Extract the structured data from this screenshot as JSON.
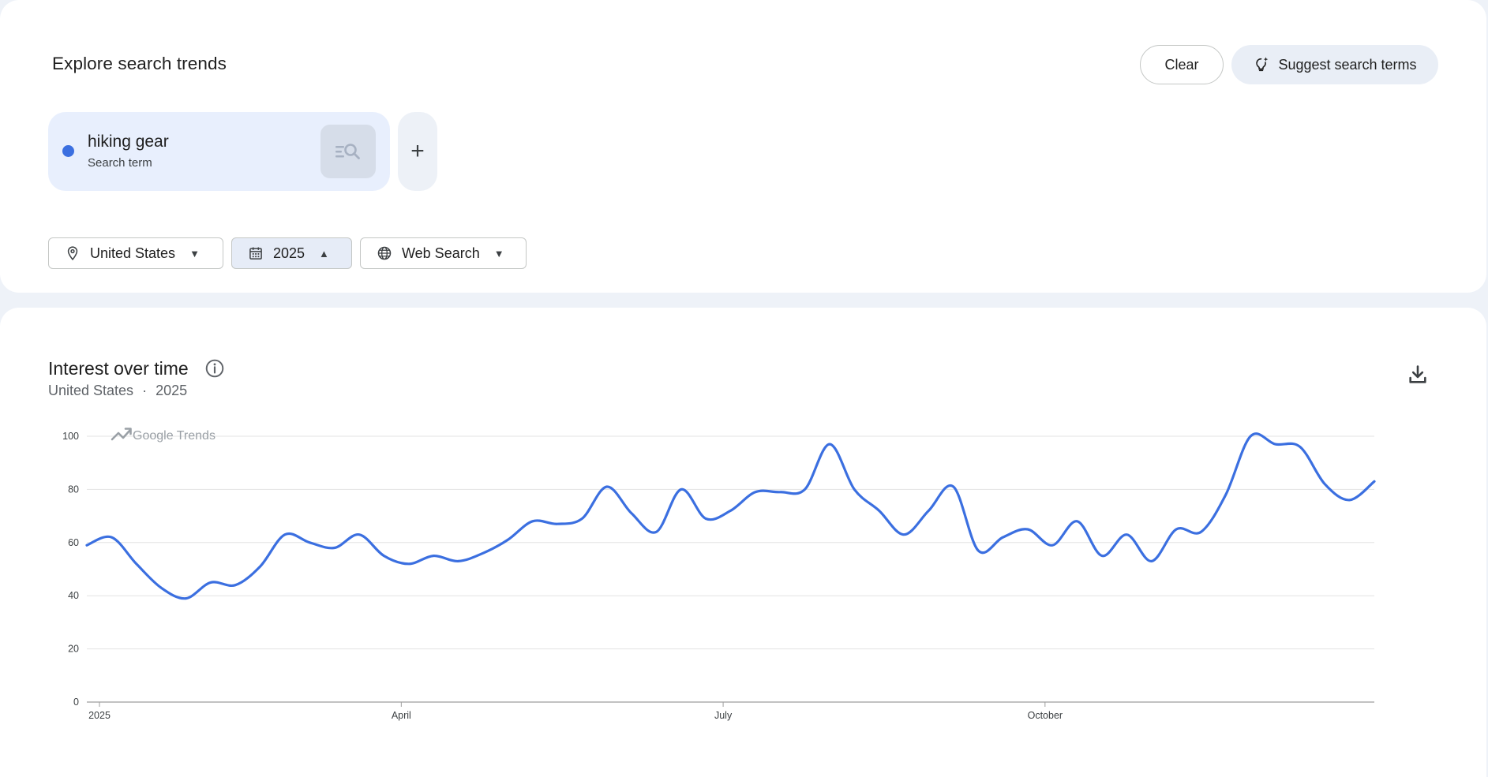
{
  "header": {
    "title": "Explore search trends",
    "clear_label": "Clear",
    "suggest_label": "Suggest search terms"
  },
  "term": {
    "name": "hiking gear",
    "sub": "Search term",
    "color": "#3b6fe0"
  },
  "add_term_label": "+",
  "filters": {
    "location": "United States",
    "date": "2025",
    "property": "Web Search"
  },
  "chart_card": {
    "title": "Interest over time",
    "subtitle_location": "United States",
    "subtitle_sep": "·",
    "subtitle_date": "2025",
    "watermark": "Google Trends"
  },
  "chart_data": {
    "type": "line",
    "title": "Interest over time",
    "xlabel": "",
    "ylabel": "",
    "ylim": [
      0,
      100
    ],
    "yticks": [
      0,
      20,
      40,
      60,
      80,
      100
    ],
    "grid": true,
    "x_tick_labels": [
      {
        "label": "2025",
        "week": 0
      },
      {
        "label": "April",
        "week": 12.7
      },
      {
        "label": "July",
        "week": 25.7
      },
      {
        "label": "October",
        "week": 38.7
      }
    ],
    "series": [
      {
        "name": "hiking gear",
        "color": "#3b6fe0",
        "weeks": [
          0,
          1,
          2,
          3,
          4,
          5,
          6,
          7,
          8,
          9,
          10,
          11,
          12,
          13,
          14,
          15,
          16,
          17,
          18,
          19,
          20,
          21,
          22,
          23,
          24,
          25,
          26,
          27,
          28,
          29,
          30,
          31,
          32,
          33,
          34,
          35,
          36,
          37,
          38,
          39,
          40,
          41,
          42,
          43,
          44,
          45,
          46,
          47,
          48,
          49,
          50,
          51,
          52
        ],
        "values": [
          59,
          62,
          52,
          43,
          39,
          45,
          44,
          51,
          63,
          60,
          58,
          63,
          55,
          52,
          55,
          53,
          56,
          61,
          68,
          67,
          69,
          81,
          71,
          64,
          80,
          69,
          72,
          79,
          79,
          80,
          97,
          80,
          72,
          63,
          72,
          81,
          57,
          62,
          65,
          59,
          68,
          55,
          63,
          53,
          65,
          64,
          78,
          100,
          97,
          96,
          82,
          76,
          83
        ]
      }
    ]
  }
}
